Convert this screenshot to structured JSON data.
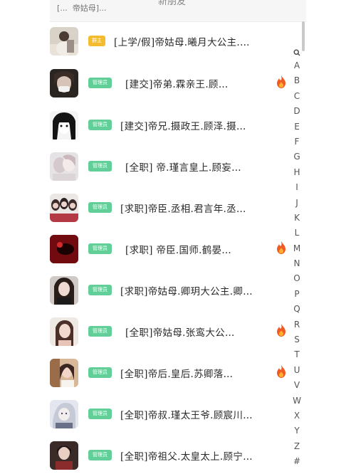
{
  "header": {
    "title": "新朋友",
    "search_placeholder": "[...  帝姑母]..."
  },
  "list": [
    {
      "name": "[上学/假]帝姑母.曦月大公主.…",
      "badge": "群主",
      "badge_color": "yellow",
      "hot": false,
      "avatar": "a1"
    },
    {
      "name": "[建交]帝弟.霖亲王.顾…",
      "badge": "管理员",
      "badge_color": "green",
      "hot": true,
      "avatar": "a2"
    },
    {
      "name": "[建交]帝兄.摄政王.顾泽.摄…",
      "badge": "管理员",
      "badge_color": "green",
      "hot": false,
      "avatar": "a3"
    },
    {
      "name": "[全职] 帝.瑾言皇上.顾妄…",
      "badge": "管理员",
      "badge_color": "green",
      "hot": false,
      "avatar": "a4"
    },
    {
      "name": "[求职]帝臣.丞相.君言年.丞…",
      "badge": "管理员",
      "badge_color": "green",
      "hot": false,
      "avatar": "a5"
    },
    {
      "name": "[求职] 帝臣.国师.鹤晏…",
      "badge": "管理员",
      "badge_color": "green",
      "hot": true,
      "avatar": "a6"
    },
    {
      "name": "[求职]帝姑母.卿玥大公主.卿…",
      "badge": "管理员",
      "badge_color": "green",
      "hot": false,
      "avatar": "a7"
    },
    {
      "name": "[全职]帝姑母.张鸾大公…",
      "badge": "管理员",
      "badge_color": "green",
      "hot": true,
      "avatar": "a8"
    },
    {
      "name": "[全职]帝后.皇后.苏卿落…",
      "badge": "管理员",
      "badge_color": "green",
      "hot": true,
      "avatar": "a9"
    },
    {
      "name": "[全职]帝叔.瑾太王爷.顾宸川…",
      "badge": "管理员",
      "badge_color": "green",
      "hot": false,
      "avatar": "a10"
    },
    {
      "name": "[全职]帝祖父.太皇太上.顾宁…",
      "badge": "管理员",
      "badge_color": "green",
      "hot": false,
      "avatar": "a11"
    }
  ],
  "index": [
    "A",
    "B",
    "C",
    "D",
    "E",
    "F",
    "G",
    "H",
    "I",
    "J",
    "K",
    "L",
    "M",
    "N",
    "O",
    "P",
    "Q",
    "R",
    "S",
    "T",
    "U",
    "V",
    "W",
    "X",
    "Y",
    "Z",
    "#"
  ],
  "colors": {
    "badge_green": "#63cf98",
    "badge_yellow": "#f3bc2f",
    "fire": "#f05a24"
  }
}
